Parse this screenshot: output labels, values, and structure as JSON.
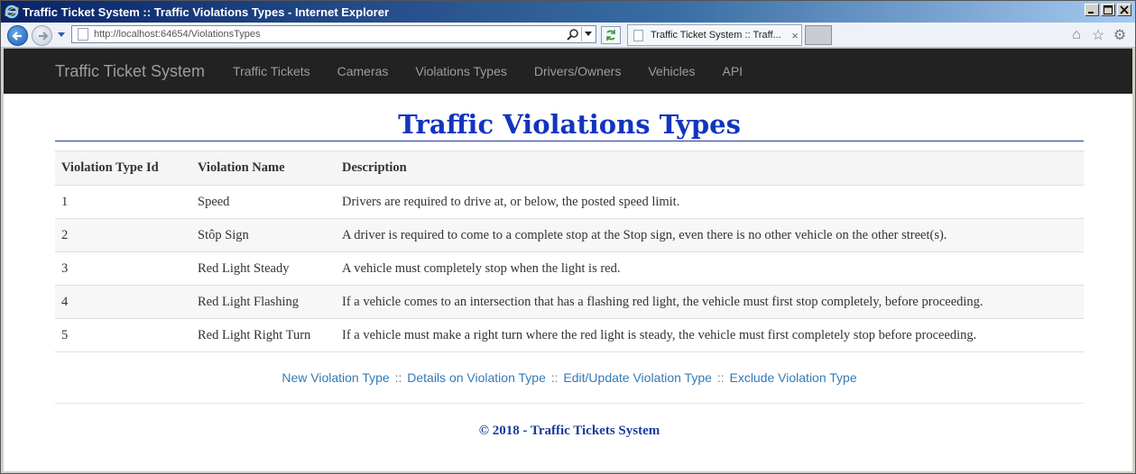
{
  "window": {
    "title": "Traffic Ticket System :: Traffic Violations Types - Internet Explorer"
  },
  "browser": {
    "address": "http://localhost:64654/ViolationsTypes",
    "tab_title": "Traffic Ticket System :: Traff...",
    "tab_close": "×"
  },
  "navbar": {
    "brand": "Traffic Ticket System",
    "links": [
      "Traffic Tickets",
      "Cameras",
      "Violations Types",
      "Drivers/Owners",
      "Vehicles",
      "API"
    ]
  },
  "page": {
    "title": "Traffic Violations Types"
  },
  "table": {
    "headers": [
      "Violation Type Id",
      "Violation Name",
      "Description"
    ],
    "rows": [
      [
        "1",
        "Speed",
        "Drivers are required to drive at, or below, the posted speed limit."
      ],
      [
        "2",
        "Stôp Sign",
        "A driver is required to come to a complete stop at the Stop sign, even there is no other vehicle on the other street(s)."
      ],
      [
        "3",
        "Red Light Steady",
        "A vehicle must completely stop when the light is red."
      ],
      [
        "4",
        "Red Light Flashing",
        "If a vehicle comes to an intersection that has a flashing red light, the vehicle must first stop completely, before proceeding."
      ],
      [
        "5",
        "Red Light Right Turn",
        "If a vehicle must make a right turn where the red light is steady, the vehicle must first completely stop before proceeding."
      ]
    ]
  },
  "actions": {
    "new": "New Violation Type",
    "details": "Details on Violation Type",
    "edit": "Edit/Update Violation Type",
    "exclude": "Exclude Violation Type",
    "separator": "::"
  },
  "footer": {
    "text": "© 2018 - Traffic Tickets System"
  },
  "colors": {
    "title": "#1234c0",
    "navbar_bg": "#222222",
    "link": "#337ab7"
  }
}
